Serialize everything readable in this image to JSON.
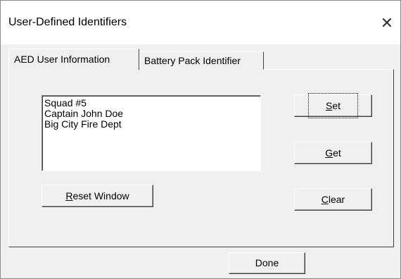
{
  "window": {
    "title": "User-Defined Identifiers",
    "close_glyph": "✕"
  },
  "tabs": [
    {
      "label": "AED User Information",
      "active": true
    },
    {
      "label": "Battery Pack Identifier",
      "active": false
    }
  ],
  "user_info": {
    "lines": [
      "Squad #5",
      "Captain John Doe",
      "Big City Fire Dept"
    ]
  },
  "buttons": {
    "set": {
      "mnemonic": "S",
      "rest": "et"
    },
    "get": {
      "mnemonic": "G",
      "rest": "et"
    },
    "clear": {
      "mnemonic": "C",
      "rest": "lear"
    },
    "reset": {
      "mnemonic": "R",
      "rest": "eset Window"
    },
    "done": {
      "label": "Done"
    }
  },
  "icons": {
    "close": "close-icon"
  }
}
